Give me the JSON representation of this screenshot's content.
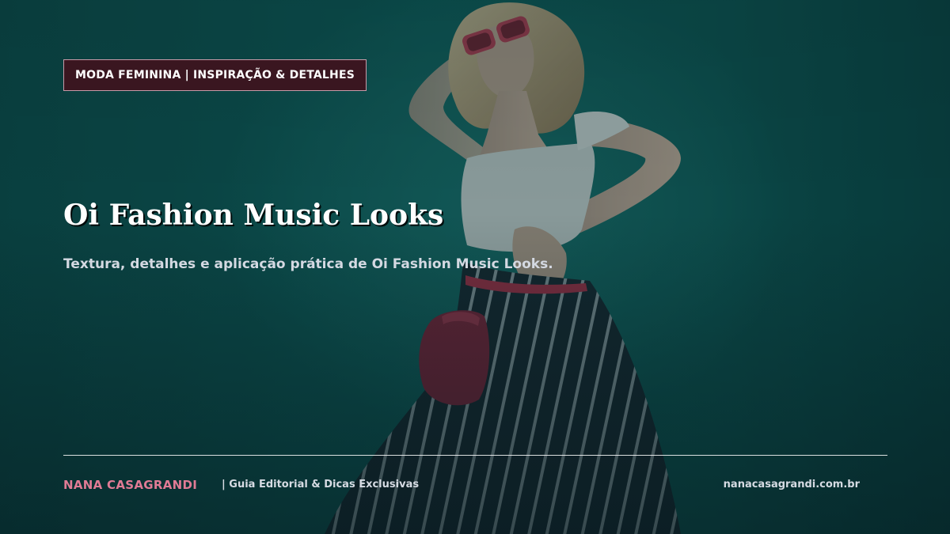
{
  "badge": {
    "label": "MODA FEMININA | INSPIRAÇÃO & DETALHES",
    "bg_color": "#3a1620"
  },
  "hero": {
    "title": "Oi Fashion Music Looks",
    "subtitle": "Textura, detalhes e aplicação prática de Oi Fashion Music Looks.",
    "image": "woman-in-striped-pants-with-red-sunglasses-and-bag"
  },
  "footer": {
    "brand": "NANA CASAGRANDI",
    "tagline": "| Guia Editorial & Dicas Exclusivas",
    "site": "nanacasagrandi.com.br",
    "brand_color": "#e07b95"
  },
  "colors": {
    "background": "#0f5d5c",
    "accent": "#e07b95",
    "text": "#ffffff"
  }
}
